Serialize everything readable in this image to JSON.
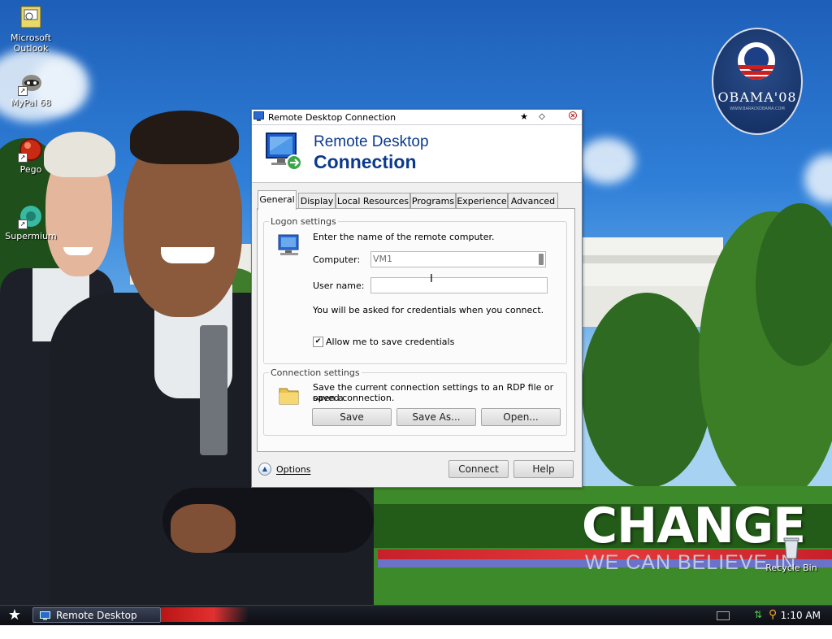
{
  "desktop": {
    "icons": [
      {
        "label": "Microsoft Outlook",
        "icon": "outlook-icon"
      },
      {
        "label": "MyPal 68",
        "icon": "raccoon-icon"
      },
      {
        "label": "Pego",
        "icon": "red-orb-icon"
      },
      {
        "label": "Supermium",
        "icon": "supermium-icon"
      },
      {
        "label": "Recycle Bin",
        "icon": "recycle-bin-icon"
      }
    ],
    "wallpaper": {
      "badge_text": "OBAMA'08",
      "badge_small": "WWW.BARACKOBAMA.COM",
      "change": "CHANGE",
      "believe": "WE CAN BELIEVE IN"
    }
  },
  "window": {
    "title": "Remote Desktop Connection",
    "banner_line1": "Remote Desktop",
    "banner_line2": "Connection",
    "tabs": [
      "General",
      "Display",
      "Local Resources",
      "Programs",
      "Experience",
      "Advanced"
    ],
    "active_tab": "General",
    "logon": {
      "title": "Logon settings",
      "instruction": "Enter the name of the remote computer.",
      "computer_label": "Computer:",
      "computer_value": "VM1",
      "username_label": "User name:",
      "username_value": "",
      "credentials_note": "You will be asked for credentials when you connect.",
      "allow_save_label": "Allow me to save credentials",
      "allow_save_checked": true
    },
    "connection": {
      "title": "Connection settings",
      "description_line1": "Save the current connection settings to an RDP file or open a",
      "description_line2": "saved connection.",
      "save": "Save",
      "save_as": "Save As...",
      "open": "Open..."
    },
    "options": "Options",
    "connect": "Connect",
    "help": "Help"
  },
  "taskbar": {
    "task_label": "Remote Desktop Co...",
    "time": "1:10 AM"
  },
  "colors": {
    "accent_blue": "#0b3a8c",
    "taskbar": "#0b0d12",
    "task_highlight": "#e23030"
  }
}
